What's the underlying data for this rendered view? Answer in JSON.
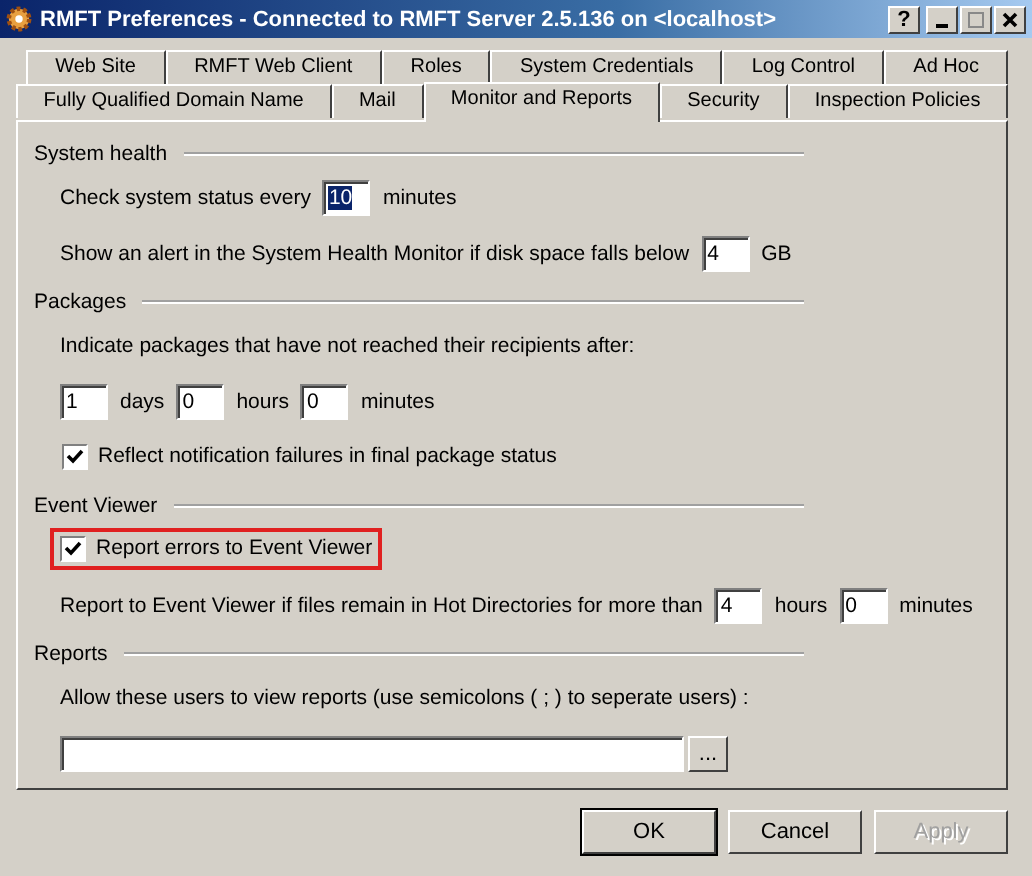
{
  "window": {
    "title": "RMFT Preferences - Connected to RMFT Server 2.5.136 on <localhost>",
    "help": "?"
  },
  "tab_rows": [
    [
      {
        "label": "Web Site",
        "selected": false
      },
      {
        "label": "RMFT Web Client",
        "selected": false
      },
      {
        "label": "Roles",
        "selected": false
      },
      {
        "label": "System Credentials",
        "selected": false
      },
      {
        "label": "Log Control",
        "selected": false
      },
      {
        "label": "Ad Hoc",
        "selected": false
      }
    ],
    [
      {
        "label": "Fully Qualified Domain Name",
        "selected": false
      },
      {
        "label": "Mail",
        "selected": false
      },
      {
        "label": "Monitor and Reports",
        "selected": true
      },
      {
        "label": "Security",
        "selected": false
      },
      {
        "label": "Inspection Policies",
        "selected": false
      }
    ]
  ],
  "sections": [
    {
      "heading": "System health",
      "lines": [
        {
          "items": [
            {
              "kind": "text",
              "text": "Check system status every"
            },
            {
              "kind": "field",
              "value": "10",
              "selected": true
            },
            {
              "kind": "text",
              "text": "minutes"
            }
          ]
        },
        {
          "items": [
            {
              "kind": "text",
              "text": "Show an alert in the System Health Monitor if disk space falls below"
            },
            {
              "kind": "field",
              "value": "4",
              "selected": false
            },
            {
              "kind": "text",
              "text": "GB"
            }
          ]
        }
      ]
    },
    {
      "heading": "Packages",
      "lines": [
        {
          "items": [
            {
              "kind": "text",
              "text": "Indicate packages that have not reached their recipients after:"
            }
          ]
        },
        {
          "items": [
            {
              "kind": "field",
              "value": "1",
              "selected": false
            },
            {
              "kind": "text",
              "text": "days"
            },
            {
              "kind": "field",
              "value": "0",
              "selected": false
            },
            {
              "kind": "text",
              "text": "hours"
            },
            {
              "kind": "field",
              "value": "0",
              "selected": false
            },
            {
              "kind": "text",
              "text": "minutes"
            }
          ]
        },
        {
          "items": [
            {
              "kind": "checkbox",
              "text": "Reflect notification failures in final package status",
              "checked": true,
              "highlighted": false
            }
          ]
        }
      ]
    },
    {
      "heading": "Event Viewer",
      "lines": [
        {
          "items": [
            {
              "kind": "checkbox",
              "text": "Report errors to Event Viewer",
              "checked": true,
              "highlighted": true
            }
          ]
        },
        {
          "items": [
            {
              "kind": "text",
              "text": "Report to Event Viewer if files remain in Hot Directories for more than"
            },
            {
              "kind": "field",
              "value": "4",
              "selected": false
            },
            {
              "kind": "text",
              "text": "hours"
            },
            {
              "kind": "field",
              "value": "0",
              "selected": false
            },
            {
              "kind": "text",
              "text": "minutes"
            }
          ]
        }
      ]
    },
    {
      "heading": "Reports",
      "lines": [
        {
          "items": [
            {
              "kind": "text",
              "text": "Allow these users to view reports (use semicolons ( ; )  to seperate users) :"
            }
          ]
        },
        {
          "items": [
            {
              "kind": "widefield"
            },
            {
              "kind": "button",
              "text": "..."
            }
          ]
        }
      ]
    }
  ],
  "buttons": [
    {
      "label": "OK",
      "disabled": false,
      "default": true
    },
    {
      "label": "Cancel",
      "disabled": false,
      "default": false
    },
    {
      "label": "Apply",
      "disabled": true,
      "default": false
    }
  ]
}
